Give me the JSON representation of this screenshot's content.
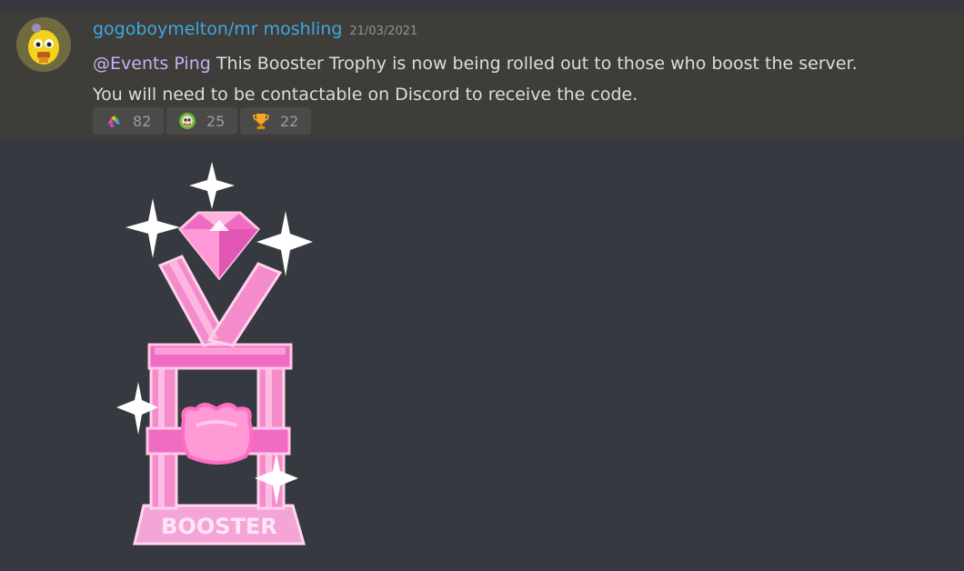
{
  "message": {
    "author": "gogoboymelton/mr moshling",
    "timestamp": "21/03/2021",
    "mention": "@Events Ping",
    "line1": " This Booster Trophy is now being rolled out to those who boost the server.",
    "line2": "You will need to be contactable on Discord to receive the code."
  },
  "reactions": [
    {
      "emoji": "rainbow-moshling-icon",
      "count": "82"
    },
    {
      "emoji": "green-moshling-icon",
      "count": "25"
    },
    {
      "emoji": "trophy-icon",
      "count": "22"
    }
  ],
  "attachment": {
    "plinth_text": "BOOSTER"
  },
  "colors": {
    "background": "#36393f",
    "message_highlight": "#3e3d3a",
    "username": "#3fa7e0",
    "mention": "#c9b0f0",
    "trophy_pink": "#f06cc4"
  }
}
